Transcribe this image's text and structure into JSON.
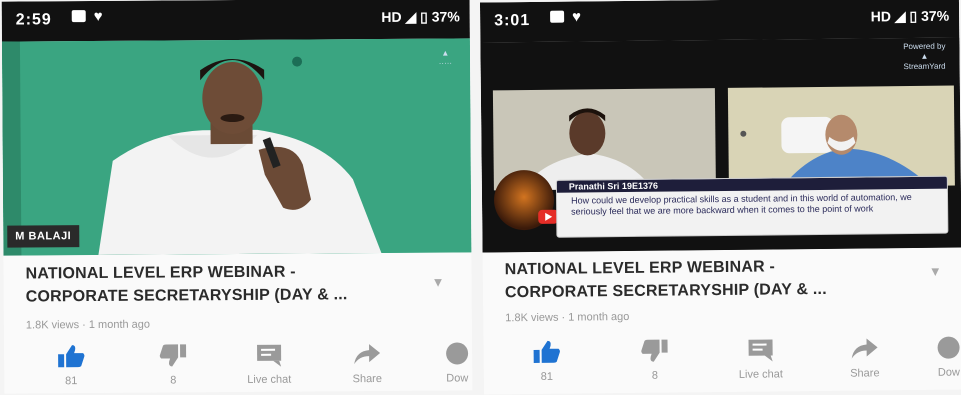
{
  "left": {
    "status": {
      "time": "2:59",
      "right": "HD ◢ ▯ 37%"
    },
    "video": {
      "nameplate": "M BALAJI"
    },
    "title_line1": "NATIONAL LEVEL ERP WEBINAR -",
    "title_line2": "CORPORATE SECRETARYSHIP (DAY & ...",
    "meta": "1.8K views · 1 month ago",
    "actions": {
      "like": "81",
      "dislike": "8",
      "chat": "Live chat",
      "share": "Share",
      "download": "Dow"
    }
  },
  "right": {
    "status": {
      "time": "3:01",
      "right": "HD ◢ ▯ 37%"
    },
    "video": {
      "chat_user": "Pranathi Sri 19E1376",
      "chat_message": "How could we develop practical skills as a student and in this world of automation, we seriously feel that we are more backward when it comes to the point of work"
    },
    "title_line1": "NATIONAL LEVEL ERP WEBINAR -",
    "title_line2": "CORPORATE SECRETARYSHIP (DAY & ...",
    "meta": "1.8K views · 1 month ago",
    "actions": {
      "like": "81",
      "dislike": "8",
      "chat": "Live chat",
      "share": "Share",
      "download": "Dow"
    }
  },
  "colors": {
    "like_blue": "#1f73d2",
    "chroma_green": "#3aa581",
    "chat_bg": "#f2f2f2"
  }
}
